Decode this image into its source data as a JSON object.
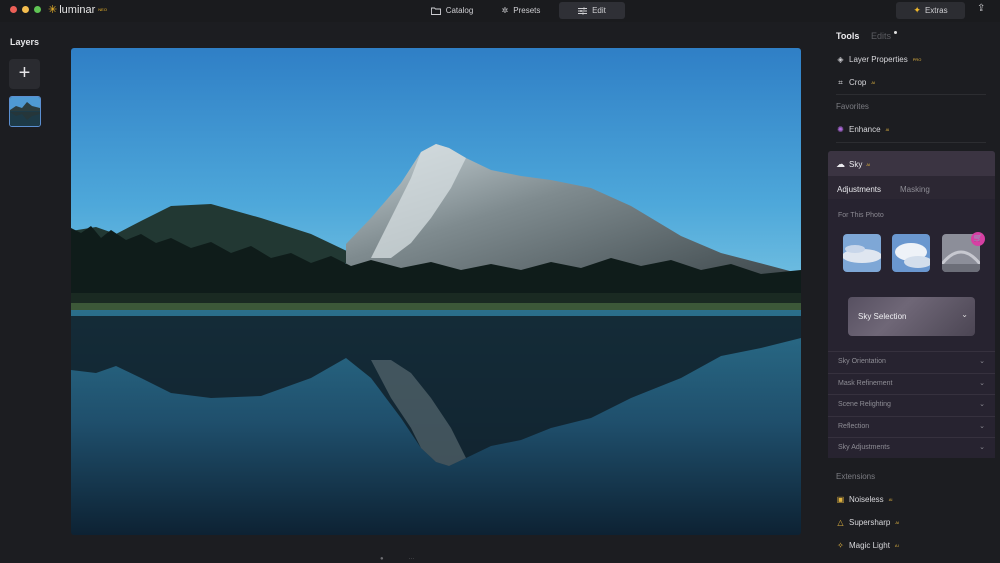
{
  "app": {
    "name": "luminar",
    "edition": "NEO"
  },
  "colors": {
    "accent_gold": "#f2b92b",
    "selection_blue": "#5b8fd1",
    "cart_pink": "#d63fa3"
  },
  "nav": {
    "catalog": "Catalog",
    "presets": "Presets",
    "edit": "Edit",
    "active": "Edit"
  },
  "extras": {
    "label": "Extras"
  },
  "layers": {
    "title": "Layers",
    "add_icon": "plus-icon"
  },
  "right": {
    "tab_tools": "Tools",
    "tab_edits": "Edits",
    "layer_properties": "Layer Properties",
    "crop": "Crop",
    "favorites_title": "Favorites",
    "enhance": "Enhance",
    "sky": {
      "title": "Sky",
      "tab_adjustments": "Adjustments",
      "tab_masking": "Masking",
      "for_this_photo": "For This Photo",
      "selection": "Sky Selection",
      "sections": [
        "Sky Orientation",
        "Mask Refinement",
        "Scene Relighting",
        "Reflection",
        "Sky Adjustments"
      ]
    },
    "extensions_title": "Extensions",
    "extensions": [
      "Noiseless",
      "Supersharp",
      "Magic Light"
    ],
    "badge": "AI",
    "pro_badge": "PRO"
  }
}
